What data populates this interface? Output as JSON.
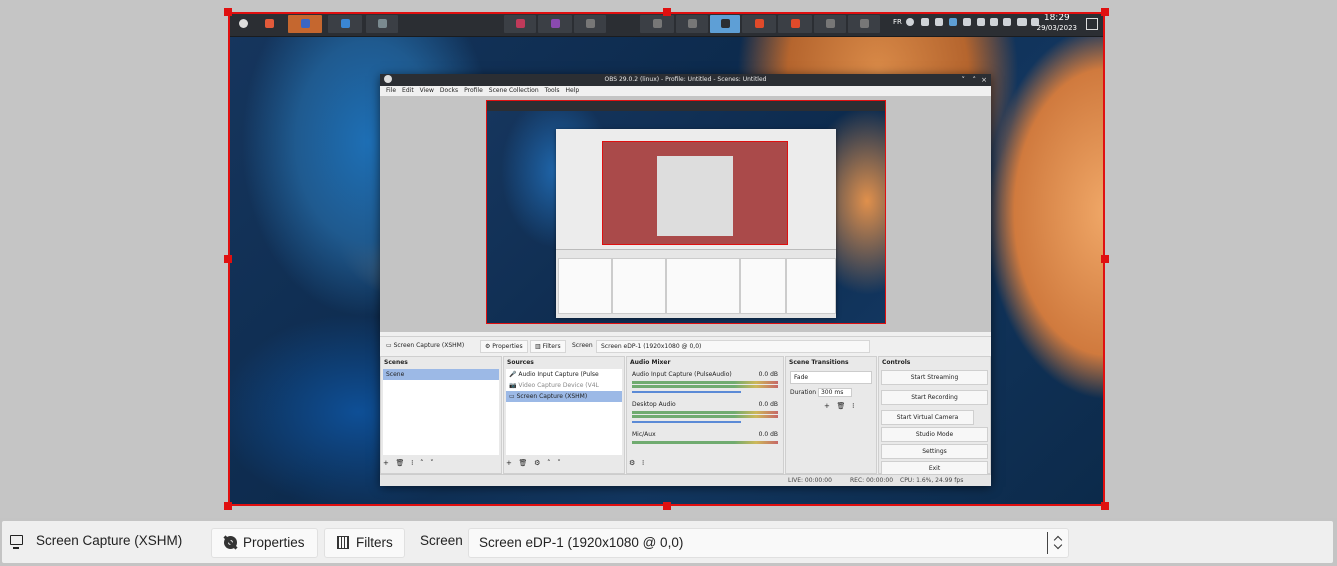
{
  "colors": {
    "selection": "#e01010",
    "accent": "#5e9fd6",
    "panel": "#efefef"
  },
  "capture": {
    "taskbar": {
      "clock_time": "18:29",
      "clock_date": "29/03/2023",
      "keyboard_layout": "FR"
    }
  },
  "obs": {
    "title": "OBS 29.0.2 (linux) - Profile: Untitled - Scenes: Untitled",
    "menu": [
      "File",
      "Edit",
      "View",
      "Docks",
      "Profile",
      "Scene Collection",
      "Tools",
      "Help"
    ],
    "context": {
      "source": "Screen Capture (XSHM)",
      "properties": "Properties",
      "filters": "Filters",
      "screen_label": "Screen",
      "screen_value": "Screen eDP-1 (1920x1080 @ 0,0)"
    },
    "docks": {
      "scenes": {
        "title": "Scenes",
        "items": [
          "Scene"
        ]
      },
      "sources": {
        "title": "Sources",
        "items": [
          "Audio Input Capture (Pulse",
          "Video Capture Device (V4L",
          "Screen Capture (XSHM)"
        ]
      },
      "mixer": {
        "title": "Audio Mixer",
        "channels": [
          {
            "name": "Audio Input Capture (PulseAudio)",
            "level": "0.0 dB"
          },
          {
            "name": "Desktop Audio",
            "level": "0.0 dB"
          },
          {
            "name": "Mic/Aux",
            "level": "0.0 dB"
          }
        ]
      },
      "transitions": {
        "title": "Scene Transitions",
        "type": "Fade",
        "duration_label": "Duration",
        "duration_value": "300 ms"
      },
      "controls": {
        "title": "Controls",
        "buttons": [
          "Start Streaming",
          "Start Recording",
          "Start Virtual Camera",
          "Studio Mode",
          "Settings",
          "Exit"
        ]
      }
    },
    "status": {
      "live": "LIVE: 00:00:00",
      "rec": "REC: 00:00:00",
      "cpu": "CPU: 1.6%, 24.99 fps"
    }
  },
  "context_bar": {
    "source_name": "Screen Capture (XSHM)",
    "properties_label": "Properties",
    "filters_label": "Filters",
    "screen_label": "Screen",
    "screen_value": "Screen eDP-1 (1920x1080 @ 0,0)"
  }
}
